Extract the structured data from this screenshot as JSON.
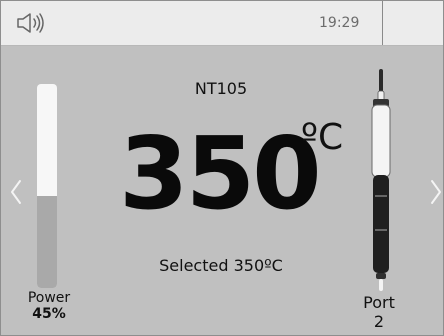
{
  "status_bar": {
    "time": "19:29",
    "icons": {
      "sound": "speaker-volume-icon"
    }
  },
  "station": {
    "tool_name": "NT105",
    "temperature": "350",
    "temperature_unit": "ºC",
    "selected_text": "Selected 350ºC"
  },
  "power": {
    "label": "Power",
    "value": "45%",
    "level_percent": 45,
    "track_color": "#f7f7f7",
    "fill_color": "#a9a9a9"
  },
  "port": {
    "label": "Port",
    "value": "2"
  },
  "navigation": {
    "prev_icon": "chevron-left-icon",
    "next_icon": "chevron-right-icon"
  },
  "colors": {
    "background": "#c0c0c0",
    "status_bar": "#ececec",
    "text": "#111111"
  }
}
